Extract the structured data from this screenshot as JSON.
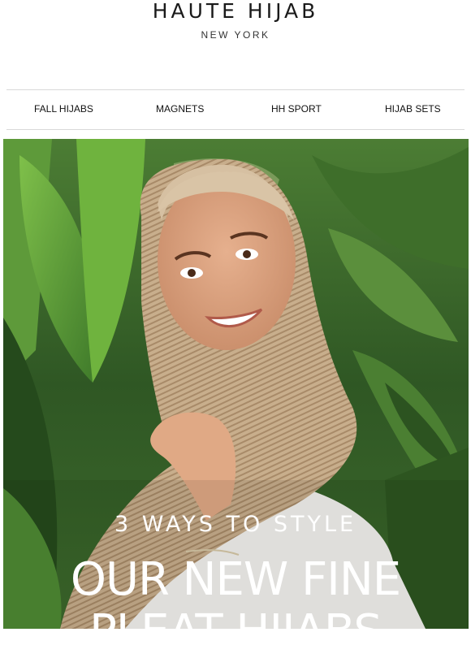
{
  "brand": {
    "name": "HAUTE HIJAB",
    "tagline": "NEW YORK"
  },
  "nav": {
    "items": [
      {
        "label": "FALL HIJABS"
      },
      {
        "label": "MAGNETS"
      },
      {
        "label": "HH SPORT"
      },
      {
        "label": "HIJAB SETS"
      }
    ]
  },
  "hero": {
    "subtitle": "3 WAYS TO STYLE",
    "title_line1": "OUR NEW FINE",
    "title_line2": "PLEAT HIJABS"
  }
}
